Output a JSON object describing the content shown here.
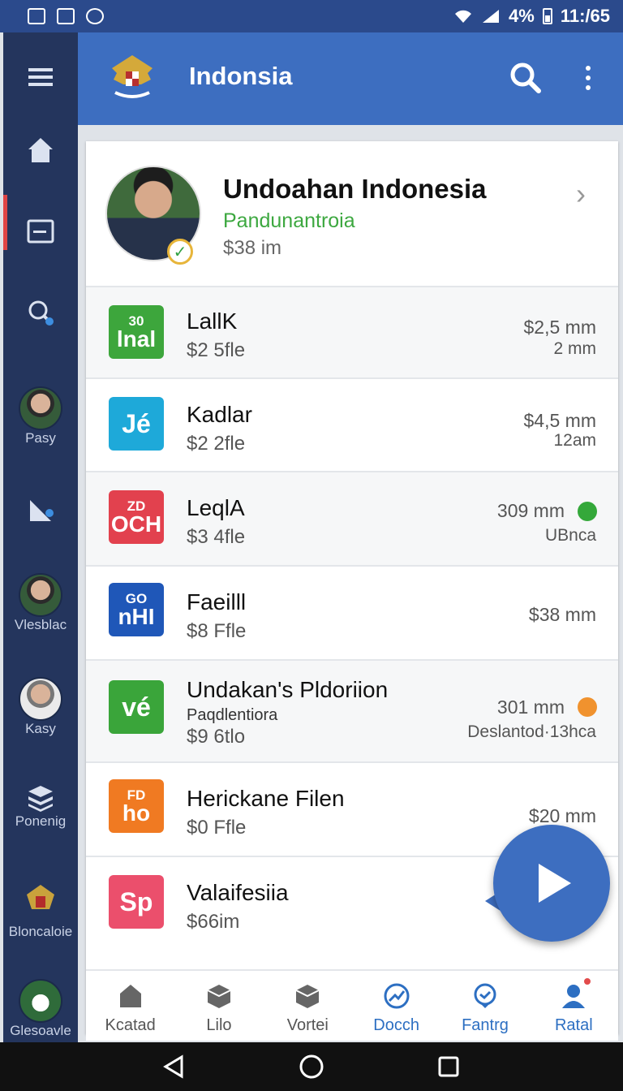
{
  "status_bar": {
    "battery": "4%",
    "time": "11:/65",
    "icons": [
      "gallery-icon",
      "edit-icon",
      "messenger-icon",
      "wifi-icon",
      "cell-signal-icon",
      "battery-icon"
    ]
  },
  "side_rail": {
    "items": [
      {
        "icon": "menu-icon",
        "label": ""
      },
      {
        "icon": "home-icon",
        "label": ""
      },
      {
        "icon": "card-icon",
        "label": ""
      },
      {
        "icon": "search-people-icon",
        "label": ""
      },
      {
        "icon": "avatar",
        "label": "Pasy"
      },
      {
        "icon": "satellite-icon",
        "label": ""
      },
      {
        "icon": "avatar",
        "label": "Vlesblac"
      },
      {
        "icon": "avatar",
        "label": "Kasy"
      },
      {
        "icon": "stack-icon",
        "label": "Ponenig"
      },
      {
        "icon": "emblem-icon",
        "label": "Bloncaloie"
      },
      {
        "icon": "house-avatar",
        "label": "Glesoavle"
      }
    ]
  },
  "app_bar": {
    "title": "Indonsia",
    "icons": [
      "garuda-emblem-icon",
      "search-icon",
      "more-vert-icon"
    ]
  },
  "profile": {
    "name": "Undoahan Indonesia",
    "subtitle": "Pandunantroia",
    "amount": "$38 im"
  },
  "items": [
    {
      "tile_top": "30",
      "tile_text": "lnal",
      "tile_color": "#3da63c",
      "title": "LallK",
      "amount": "$2 5fle",
      "right_top": "$2,5 mm",
      "right_bottom": "2 mm"
    },
    {
      "tile_top": "",
      "tile_text": "Jé",
      "tile_color": "#1ea9d9",
      "title": "Kadlar",
      "amount": "$2 2fle",
      "right_top": "$4,5 mm",
      "right_bottom": "12am"
    },
    {
      "tile_top": "ZD",
      "tile_text": "OCH",
      "tile_color": "#e2414e",
      "title": "LeqlA",
      "amount": "$3 4fle",
      "right_top": "309 mm",
      "right_bottom": "UBnca",
      "dot_color": "#34a83a"
    },
    {
      "tile_top": "GO",
      "tile_text": "nHI",
      "tile_color": "#1f57b8",
      "title": "Faeilll",
      "amount": "$8 Ffle",
      "right_top": "$38 mm",
      "right_bottom": ""
    },
    {
      "tile_top": "",
      "tile_text": "vé",
      "tile_color": "#3aa53a",
      "title": "Undakan's Pldoriion",
      "subtitle": "Paqdlentiora",
      "amount": "$9 6tlo",
      "right_top": "301 mm",
      "right_bottom": "Deslantod·13hca",
      "dot_color": "#f0922e"
    },
    {
      "tile_top": "FD",
      "tile_text": "ho",
      "tile_color": "#f07a22",
      "title": "Herickane Filen",
      "amount": "$0 Ffle",
      "right_top": "$20 mm",
      "right_bottom": ""
    },
    {
      "tile_top": "",
      "tile_text": "Sp",
      "tile_color": "#eb4f6c",
      "title": "Valaifesiia",
      "amount": "$66im",
      "right_top": "",
      "right_bottom": ""
    }
  ],
  "fab": {
    "icon": "play-icon"
  },
  "bottom_tabs": [
    {
      "label": "Kcatad",
      "icon": "home-icon"
    },
    {
      "label": "Lilo",
      "icon": "box-icon"
    },
    {
      "label": "Vortei",
      "icon": "box-icon"
    },
    {
      "label": "Docch",
      "icon": "trending-icon",
      "active": true
    },
    {
      "label": "Fantrg",
      "icon": "chat-icon"
    },
    {
      "label": "Ratal",
      "icon": "profile-icon",
      "badge": true
    }
  ],
  "nav_bar": {
    "icons": [
      "back-icon",
      "home-circle-icon",
      "recents-icon"
    ]
  },
  "colors": {
    "app_bar": "#3d6ec0",
    "rail": "#24355d",
    "accent": "#2d6fc2"
  }
}
